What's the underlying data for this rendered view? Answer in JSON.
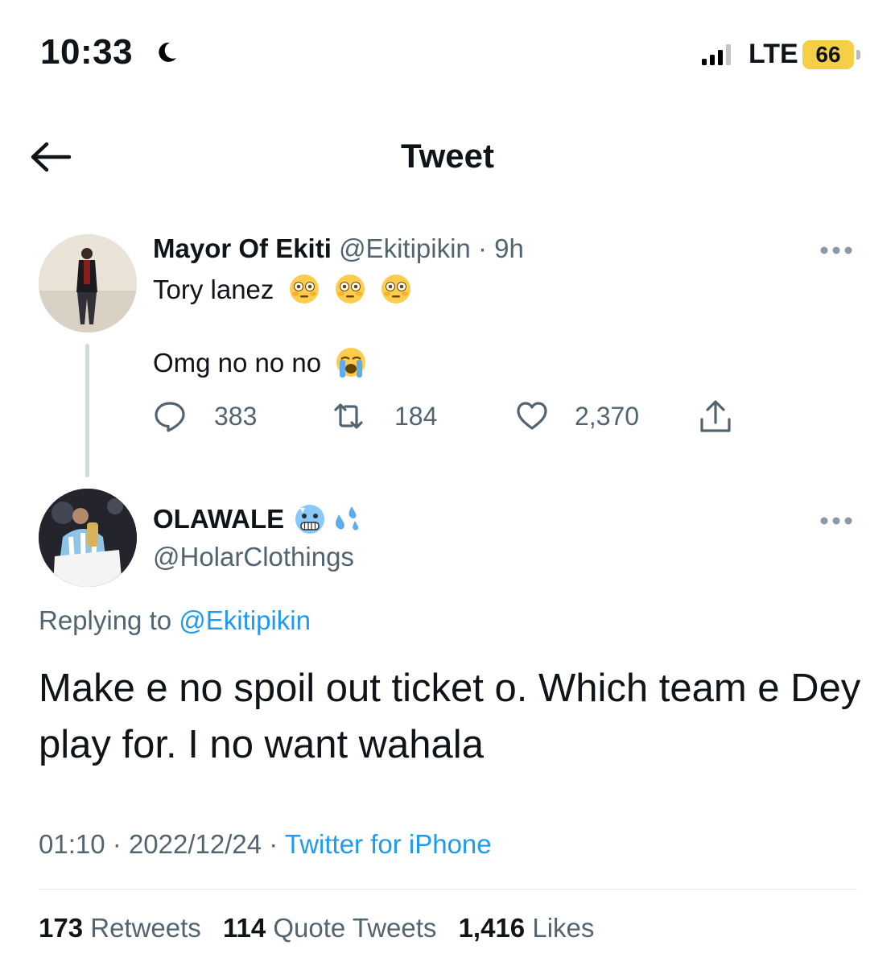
{
  "status_bar": {
    "time": "10:33",
    "network": "LTE",
    "battery": "66",
    "battery_color": "#f5cf45"
  },
  "header": {
    "title": "Tweet",
    "back_icon": "arrow-left-icon"
  },
  "parent_tweet": {
    "name": "Mayor Of Ekiti",
    "handle": "@Ekitipikin",
    "separator": "·",
    "age": "9h",
    "line1": "Tory lanez",
    "line2": "Omg no no no",
    "emojis_line1": [
      "flushed-face",
      "flushed-face",
      "flushed-face"
    ],
    "emoji_line2": "loudly-crying-face",
    "replies": "383",
    "retweets": "184",
    "likes": "2,370"
  },
  "main_tweet": {
    "name": "OLAWALE",
    "name_emojis": [
      "cold-face",
      "sweat-droplets"
    ],
    "handle": "@HolarClothings",
    "replying_prefix": "Replying to",
    "replying_to": "@Ekitipikin",
    "text": "Make e no spoil out ticket o. Which team e Dey play for. I no want wahala",
    "time": "01:10",
    "date": "2022/12/24",
    "separator": "·",
    "source": "Twitter for iPhone",
    "retweets_count": "173",
    "retweets_label": "Retweets",
    "quotes_count": "114",
    "quotes_label": "Quote Tweets",
    "likes_count": "1,416",
    "likes_label": "Likes"
  },
  "colors": {
    "link": "#1d9bf0",
    "secondary_text": "#536471",
    "primary_text": "#0f1419"
  }
}
